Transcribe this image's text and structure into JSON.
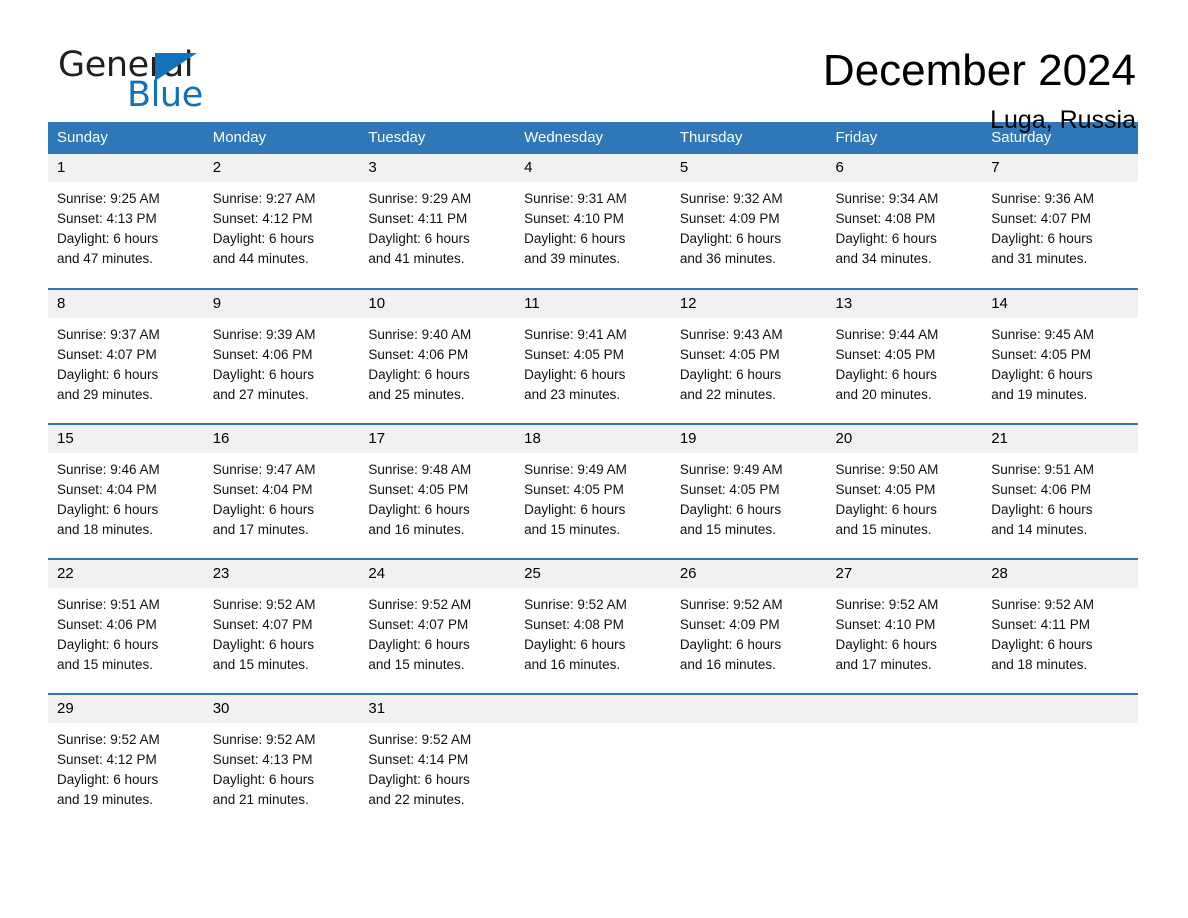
{
  "brand": {
    "name_part1": "General",
    "name_part2": "Blue",
    "triangle_color": "#1271bb"
  },
  "header": {
    "month_title": "December 2024",
    "location": "Luga, Russia"
  },
  "colors": {
    "header_blue": "#2e77b8",
    "date_band": "#f1f1f1",
    "brand_blue": "#1271bb"
  },
  "calendar": {
    "weekday_headers": [
      "Sunday",
      "Monday",
      "Tuesday",
      "Wednesday",
      "Thursday",
      "Friday",
      "Saturday"
    ],
    "weeks": [
      [
        {
          "day": "1",
          "sunrise": "Sunrise: 9:25 AM",
          "sunset": "Sunset: 4:13 PM",
          "daylight_l1": "Daylight: 6 hours",
          "daylight_l2": "and 47 minutes."
        },
        {
          "day": "2",
          "sunrise": "Sunrise: 9:27 AM",
          "sunset": "Sunset: 4:12 PM",
          "daylight_l1": "Daylight: 6 hours",
          "daylight_l2": "and 44 minutes."
        },
        {
          "day": "3",
          "sunrise": "Sunrise: 9:29 AM",
          "sunset": "Sunset: 4:11 PM",
          "daylight_l1": "Daylight: 6 hours",
          "daylight_l2": "and 41 minutes."
        },
        {
          "day": "4",
          "sunrise": "Sunrise: 9:31 AM",
          "sunset": "Sunset: 4:10 PM",
          "daylight_l1": "Daylight: 6 hours",
          "daylight_l2": "and 39 minutes."
        },
        {
          "day": "5",
          "sunrise": "Sunrise: 9:32 AM",
          "sunset": "Sunset: 4:09 PM",
          "daylight_l1": "Daylight: 6 hours",
          "daylight_l2": "and 36 minutes."
        },
        {
          "day": "6",
          "sunrise": "Sunrise: 9:34 AM",
          "sunset": "Sunset: 4:08 PM",
          "daylight_l1": "Daylight: 6 hours",
          "daylight_l2": "and 34 minutes."
        },
        {
          "day": "7",
          "sunrise": "Sunrise: 9:36 AM",
          "sunset": "Sunset: 4:07 PM",
          "daylight_l1": "Daylight: 6 hours",
          "daylight_l2": "and 31 minutes."
        }
      ],
      [
        {
          "day": "8",
          "sunrise": "Sunrise: 9:37 AM",
          "sunset": "Sunset: 4:07 PM",
          "daylight_l1": "Daylight: 6 hours",
          "daylight_l2": "and 29 minutes."
        },
        {
          "day": "9",
          "sunrise": "Sunrise: 9:39 AM",
          "sunset": "Sunset: 4:06 PM",
          "daylight_l1": "Daylight: 6 hours",
          "daylight_l2": "and 27 minutes."
        },
        {
          "day": "10",
          "sunrise": "Sunrise: 9:40 AM",
          "sunset": "Sunset: 4:06 PM",
          "daylight_l1": "Daylight: 6 hours",
          "daylight_l2": "and 25 minutes."
        },
        {
          "day": "11",
          "sunrise": "Sunrise: 9:41 AM",
          "sunset": "Sunset: 4:05 PM",
          "daylight_l1": "Daylight: 6 hours",
          "daylight_l2": "and 23 minutes."
        },
        {
          "day": "12",
          "sunrise": "Sunrise: 9:43 AM",
          "sunset": "Sunset: 4:05 PM",
          "daylight_l1": "Daylight: 6 hours",
          "daylight_l2": "and 22 minutes."
        },
        {
          "day": "13",
          "sunrise": "Sunrise: 9:44 AM",
          "sunset": "Sunset: 4:05 PM",
          "daylight_l1": "Daylight: 6 hours",
          "daylight_l2": "and 20 minutes."
        },
        {
          "day": "14",
          "sunrise": "Sunrise: 9:45 AM",
          "sunset": "Sunset: 4:05 PM",
          "daylight_l1": "Daylight: 6 hours",
          "daylight_l2": "and 19 minutes."
        }
      ],
      [
        {
          "day": "15",
          "sunrise": "Sunrise: 9:46 AM",
          "sunset": "Sunset: 4:04 PM",
          "daylight_l1": "Daylight: 6 hours",
          "daylight_l2": "and 18 minutes."
        },
        {
          "day": "16",
          "sunrise": "Sunrise: 9:47 AM",
          "sunset": "Sunset: 4:04 PM",
          "daylight_l1": "Daylight: 6 hours",
          "daylight_l2": "and 17 minutes."
        },
        {
          "day": "17",
          "sunrise": "Sunrise: 9:48 AM",
          "sunset": "Sunset: 4:05 PM",
          "daylight_l1": "Daylight: 6 hours",
          "daylight_l2": "and 16 minutes."
        },
        {
          "day": "18",
          "sunrise": "Sunrise: 9:49 AM",
          "sunset": "Sunset: 4:05 PM",
          "daylight_l1": "Daylight: 6 hours",
          "daylight_l2": "and 15 minutes."
        },
        {
          "day": "19",
          "sunrise": "Sunrise: 9:49 AM",
          "sunset": "Sunset: 4:05 PM",
          "daylight_l1": "Daylight: 6 hours",
          "daylight_l2": "and 15 minutes."
        },
        {
          "day": "20",
          "sunrise": "Sunrise: 9:50 AM",
          "sunset": "Sunset: 4:05 PM",
          "daylight_l1": "Daylight: 6 hours",
          "daylight_l2": "and 15 minutes."
        },
        {
          "day": "21",
          "sunrise": "Sunrise: 9:51 AM",
          "sunset": "Sunset: 4:06 PM",
          "daylight_l1": "Daylight: 6 hours",
          "daylight_l2": "and 14 minutes."
        }
      ],
      [
        {
          "day": "22",
          "sunrise": "Sunrise: 9:51 AM",
          "sunset": "Sunset: 4:06 PM",
          "daylight_l1": "Daylight: 6 hours",
          "daylight_l2": "and 15 minutes."
        },
        {
          "day": "23",
          "sunrise": "Sunrise: 9:52 AM",
          "sunset": "Sunset: 4:07 PM",
          "daylight_l1": "Daylight: 6 hours",
          "daylight_l2": "and 15 minutes."
        },
        {
          "day": "24",
          "sunrise": "Sunrise: 9:52 AM",
          "sunset": "Sunset: 4:07 PM",
          "daylight_l1": "Daylight: 6 hours",
          "daylight_l2": "and 15 minutes."
        },
        {
          "day": "25",
          "sunrise": "Sunrise: 9:52 AM",
          "sunset": "Sunset: 4:08 PM",
          "daylight_l1": "Daylight: 6 hours",
          "daylight_l2": "and 16 minutes."
        },
        {
          "day": "26",
          "sunrise": "Sunrise: 9:52 AM",
          "sunset": "Sunset: 4:09 PM",
          "daylight_l1": "Daylight: 6 hours",
          "daylight_l2": "and 16 minutes."
        },
        {
          "day": "27",
          "sunrise": "Sunrise: 9:52 AM",
          "sunset": "Sunset: 4:10 PM",
          "daylight_l1": "Daylight: 6 hours",
          "daylight_l2": "and 17 minutes."
        },
        {
          "day": "28",
          "sunrise": "Sunrise: 9:52 AM",
          "sunset": "Sunset: 4:11 PM",
          "daylight_l1": "Daylight: 6 hours",
          "daylight_l2": "and 18 minutes."
        }
      ],
      [
        {
          "day": "29",
          "sunrise": "Sunrise: 9:52 AM",
          "sunset": "Sunset: 4:12 PM",
          "daylight_l1": "Daylight: 6 hours",
          "daylight_l2": "and 19 minutes."
        },
        {
          "day": "30",
          "sunrise": "Sunrise: 9:52 AM",
          "sunset": "Sunset: 4:13 PM",
          "daylight_l1": "Daylight: 6 hours",
          "daylight_l2": "and 21 minutes."
        },
        {
          "day": "31",
          "sunrise": "Sunrise: 9:52 AM",
          "sunset": "Sunset: 4:14 PM",
          "daylight_l1": "Daylight: 6 hours",
          "daylight_l2": "and 22 minutes."
        },
        {
          "day": "",
          "sunrise": "",
          "sunset": "",
          "daylight_l1": "",
          "daylight_l2": ""
        },
        {
          "day": "",
          "sunrise": "",
          "sunset": "",
          "daylight_l1": "",
          "daylight_l2": ""
        },
        {
          "day": "",
          "sunrise": "",
          "sunset": "",
          "daylight_l1": "",
          "daylight_l2": ""
        },
        {
          "day": "",
          "sunrise": "",
          "sunset": "",
          "daylight_l1": "",
          "daylight_l2": ""
        }
      ]
    ]
  }
}
